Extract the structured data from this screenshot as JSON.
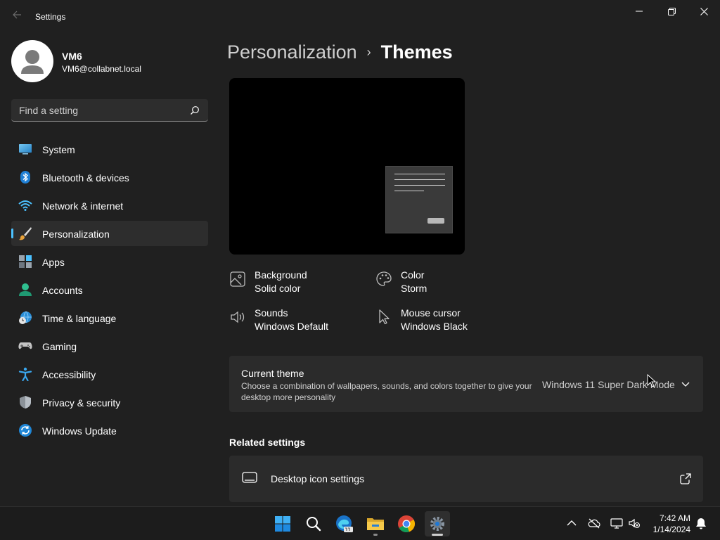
{
  "window": {
    "title": "Settings"
  },
  "user": {
    "name": "VM6",
    "email": "VM6@collabnet.local"
  },
  "search": {
    "placeholder": "Find a setting"
  },
  "sidebar": {
    "items": [
      {
        "label": "System",
        "icon": "system-icon"
      },
      {
        "label": "Bluetooth & devices",
        "icon": "bluetooth-icon"
      },
      {
        "label": "Network & internet",
        "icon": "wifi-icon"
      },
      {
        "label": "Personalization",
        "icon": "brush-icon",
        "active": true
      },
      {
        "label": "Apps",
        "icon": "apps-icon"
      },
      {
        "label": "Accounts",
        "icon": "person-icon"
      },
      {
        "label": "Time & language",
        "icon": "globe-clock-icon"
      },
      {
        "label": "Gaming",
        "icon": "gamepad-icon"
      },
      {
        "label": "Accessibility",
        "icon": "accessibility-icon"
      },
      {
        "label": "Privacy & security",
        "icon": "shield-icon"
      },
      {
        "label": "Windows Update",
        "icon": "update-icon"
      }
    ]
  },
  "breadcrumb": {
    "parent": "Personalization",
    "separator": "›",
    "current": "Themes"
  },
  "theme_options": {
    "background": {
      "title": "Background",
      "value": "Solid color"
    },
    "color": {
      "title": "Color",
      "value": "Storm"
    },
    "sounds": {
      "title": "Sounds",
      "value": "Windows Default"
    },
    "mouse_cursor": {
      "title": "Mouse cursor",
      "value": "Windows Black"
    }
  },
  "current_theme": {
    "title": "Current theme",
    "description": "Choose a combination of wallpapers, sounds, and colors together to give your desktop more personality",
    "selected": "Windows 11 Super Dark Mode"
  },
  "related_settings": {
    "title": "Related settings",
    "items": [
      {
        "label": "Desktop icon settings"
      }
    ]
  },
  "taskbar": {
    "apps": [
      "start-icon",
      "search-icon",
      "edge-beta-icon",
      "file-explorer-icon",
      "chrome-icon",
      "settings-icon"
    ],
    "clock_time": "7:42 AM",
    "clock_date": "1/14/2024"
  },
  "colors": {
    "background": "#202020",
    "card": "#2b2b2b",
    "accent": "#4cc2ff",
    "taskbar": "#1c1c1c"
  }
}
